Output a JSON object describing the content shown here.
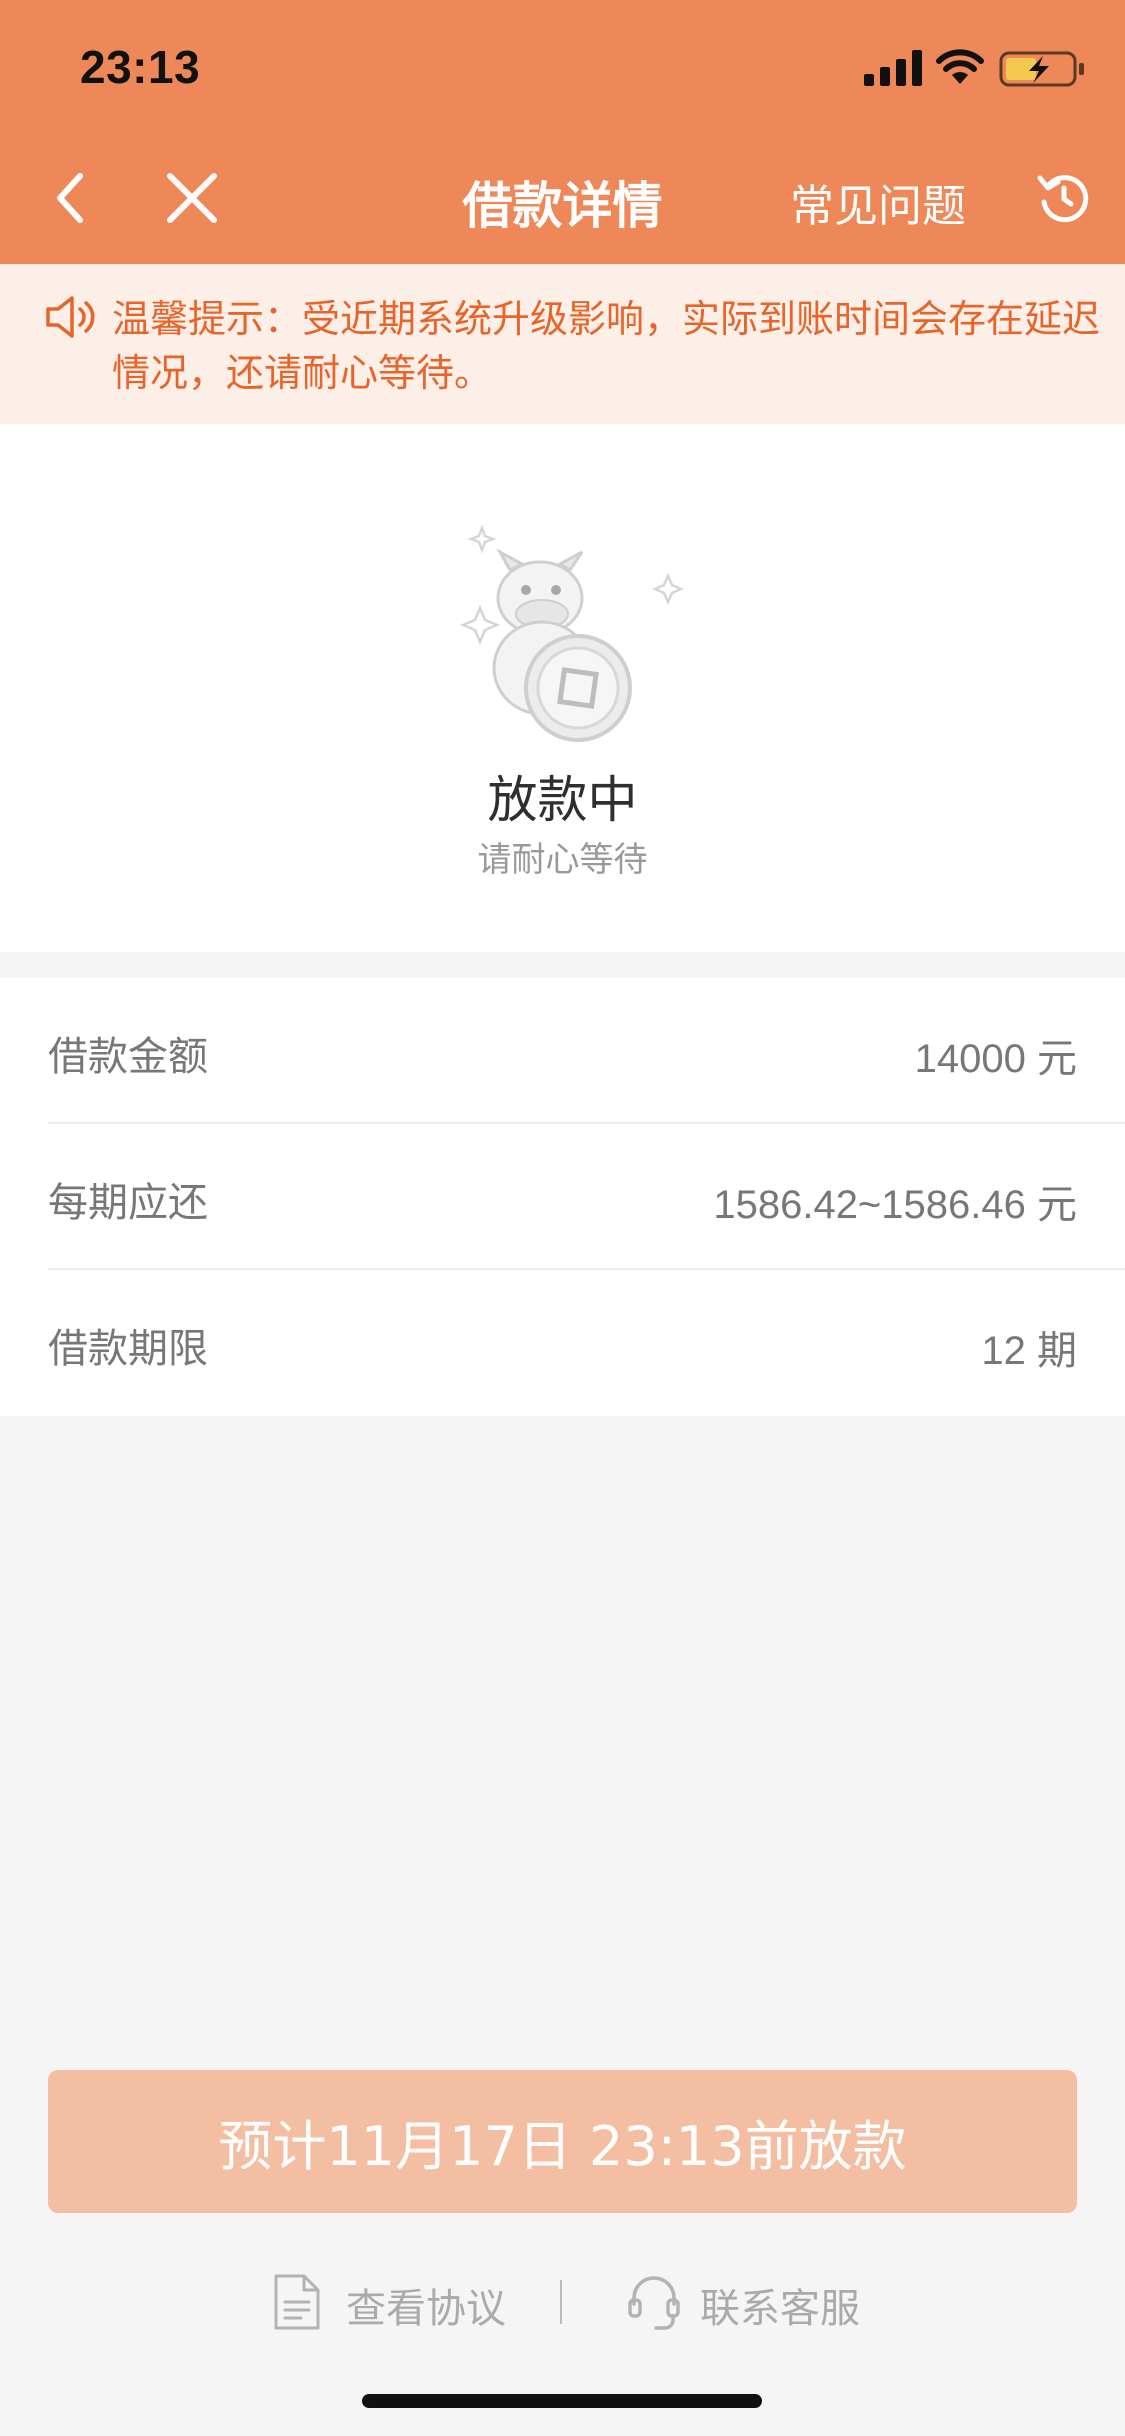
{
  "status_bar": {
    "time": "23:13",
    "icons": [
      "signal-icon",
      "wifi-icon",
      "battery-charging-icon"
    ]
  },
  "nav": {
    "title": "借款详情",
    "faq_label": "常见问题",
    "icons": [
      "back-icon",
      "close-icon",
      "refresh-icon"
    ]
  },
  "notice": {
    "text": "温馨提示：受近期系统升级影响，实际到账时间会存在延迟情况，还请耐心等待。",
    "icon": "speaker-icon"
  },
  "status": {
    "title": "放款中",
    "subtitle": "请耐心等待",
    "icon": "mascot-coin-icon"
  },
  "details": [
    {
      "label": "借款金额",
      "value": "14000 元"
    },
    {
      "label": "每期应还",
      "value": "1586.42~1586.46 元"
    },
    {
      "label": "借款期限",
      "value": "12 期"
    }
  ],
  "payout_button": {
    "label": "预计11月17日 23:13前放款"
  },
  "footer": {
    "agreement_label": "查看协议",
    "service_label": "联系客服"
  },
  "colors": {
    "header_bg": "#ee8858",
    "notice_bg": "#fcefe8",
    "notice_text": "#e8652a",
    "button_bg": "#f3bea1"
  }
}
